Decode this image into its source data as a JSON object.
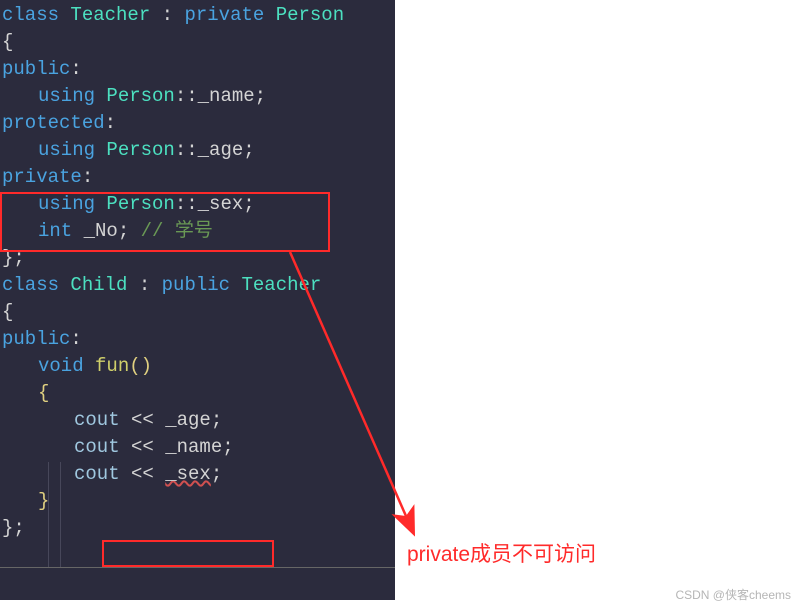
{
  "code": {
    "l1_class": "class",
    "l1_teacher": "Teacher",
    "l1_colon": " : ",
    "l1_private": "private",
    "l1_person": "Person",
    "l2_brace": "{",
    "l3_public": "public",
    "l3_colon": ":",
    "l4_using": "using",
    "l4_person": "Person",
    "l4_cc": "::",
    "l4_name": "_name",
    "l4_semi": ";",
    "l5_protected": "protected",
    "l5_colon": ":",
    "l6_using": "using",
    "l6_person": "Person",
    "l6_cc": "::",
    "l6_age": "_age",
    "l6_semi": ";",
    "l7_private": "private",
    "l7_colon": ":",
    "l8_using": "using",
    "l8_person": "Person",
    "l8_cc": "::",
    "l8_sex": "_sex",
    "l8_semi": ";",
    "l9_int": "int",
    "l9_no": "_No",
    "l9_semi": ";",
    "l9_comment": " // 学号",
    "l10_brace": "};",
    "l11_class": "class",
    "l11_child": "Child",
    "l11_colon": " : ",
    "l11_public": "public",
    "l11_teacher": "Teacher",
    "l12_brace": "{",
    "l13_public": "public",
    "l13_colon": ":",
    "l14_void": "void",
    "l14_fun": "fun",
    "l14_paren": "()",
    "l15_brace": "{",
    "l16_cout": "cout",
    "l16_op": " << ",
    "l16_age": "_age",
    "l16_semi": ";",
    "l17_cout": "cout",
    "l17_op": " << ",
    "l17_name": "_name",
    "l17_semi": ";",
    "l18_cout": "cout",
    "l18_op": " << ",
    "l18_sex": "_sex",
    "l18_semi": ";",
    "l19_brace": "}",
    "l20_brace": "};"
  },
  "annotation": "private成员不可访问",
  "watermark": "CSDN @侠客cheems"
}
